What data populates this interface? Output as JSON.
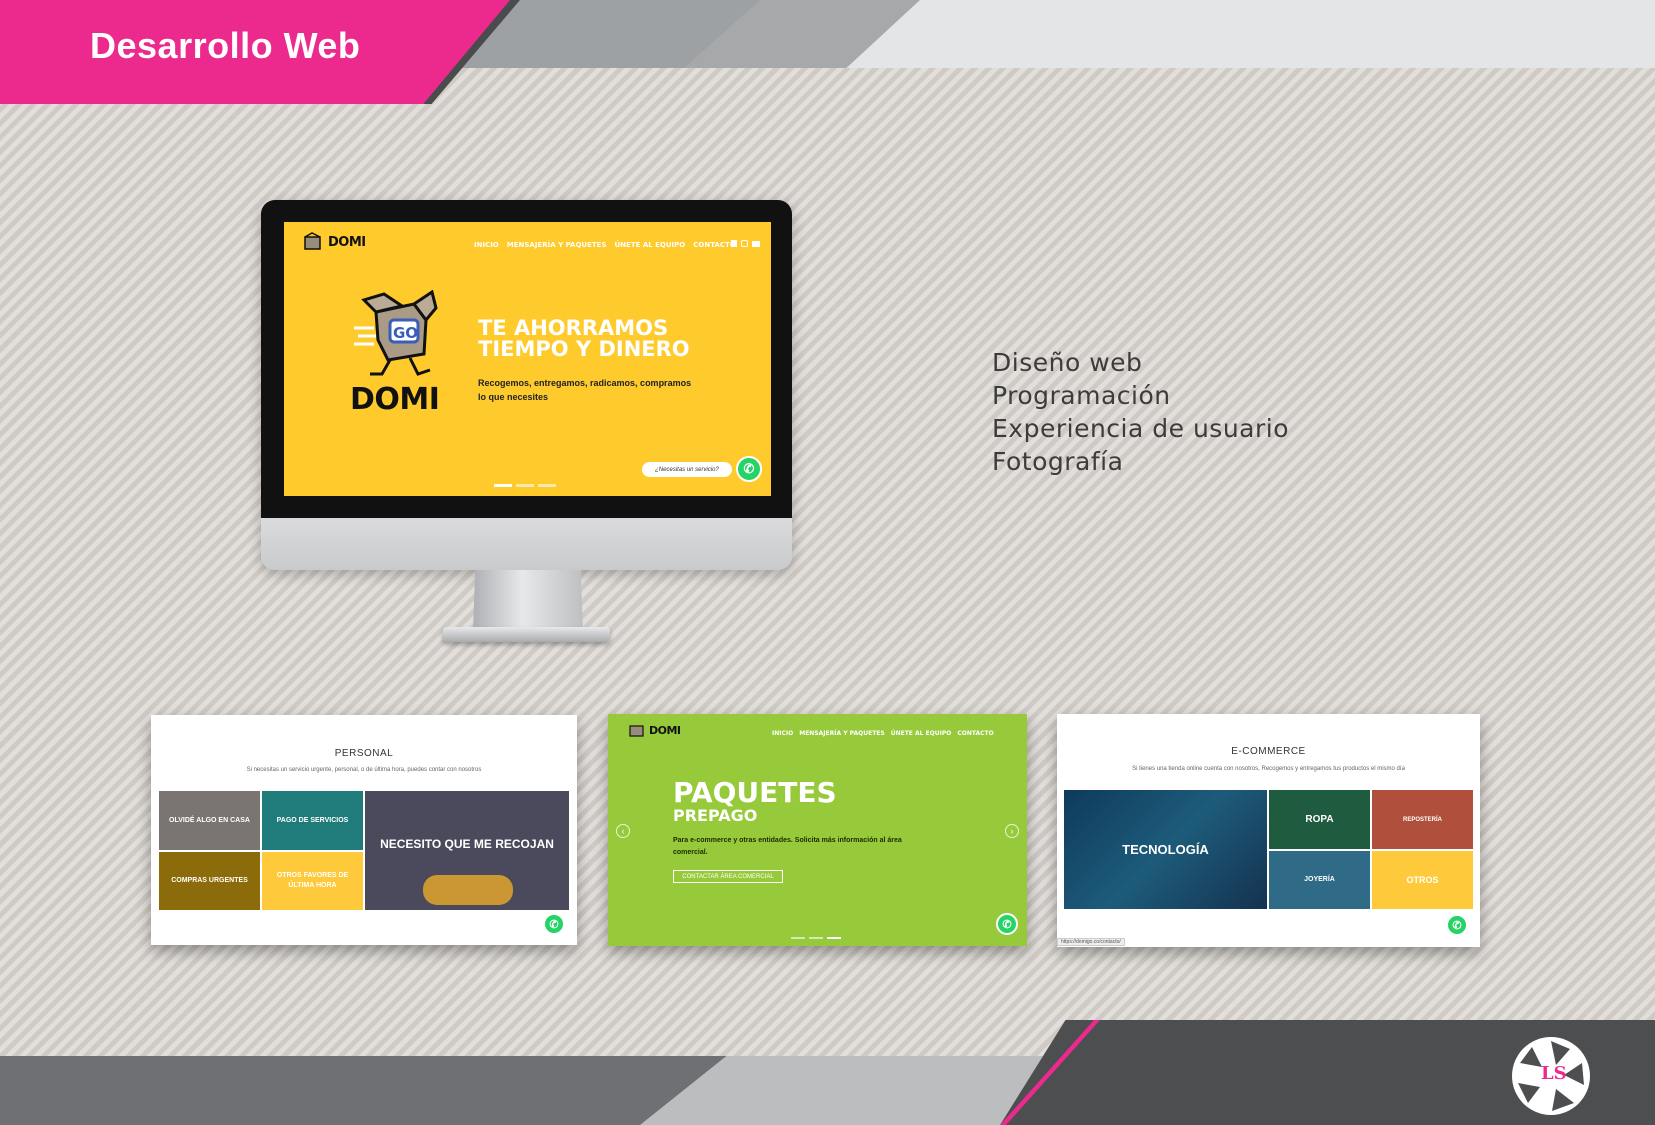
{
  "header": {
    "title": "Desarrollo Web"
  },
  "services": [
    "Diseño web",
    "Programación",
    "Experiencia de usuario",
    "Fotografía"
  ],
  "main_site": {
    "logo": "DOMI",
    "box_label": "GO",
    "nav": [
      "INICIO",
      "MENSAJERÍA Y PAQUETES",
      "ÚNETE AL EQUIPO",
      "CONTACTO"
    ],
    "hero_title_1": "TE AHORRAMOS",
    "hero_title_2": "TIEMPO Y DINERO",
    "hero_text": "Recogemos, entregamos, radicamos, compramos lo que necesites",
    "wa_prompt": "¿Necesitas un servicio?"
  },
  "thumb_personal": {
    "title": "PERSONAL",
    "subtitle": "Si necesitas un servicio urgente, personal, o de última hora, puedes contar con nosotros",
    "tiles": [
      {
        "label": "OLVIDÉ ALGO EN CASA",
        "color": "#7a7572"
      },
      {
        "label": "PAGO DE SERVICIOS",
        "color": "#1f7c7a"
      },
      {
        "label": "COMPRAS URGENTES",
        "color": "#8c6b0b"
      },
      {
        "label": "OTROS FAVORES DE ÚLTIMA HORA",
        "color": "#ffc93c"
      }
    ],
    "big_tile": "NECESITO QUE ME RECOJAN"
  },
  "thumb_paquetes": {
    "logo": "DOMI",
    "nav": [
      "INICIO",
      "MENSAJERÍA Y PAQUETES",
      "ÚNETE AL EQUIPO",
      "CONTACTO"
    ],
    "title": "PAQUETES",
    "subtitle": "PREPAGO",
    "text": "Para e-commerce y otras entidades. Solicita más información al área comercial.",
    "button": "CONTACTAR ÁREA COMERCIAL"
  },
  "thumb_ecommerce": {
    "title": "E-COMMERCE",
    "subtitle": "Si tienes una tienda online cuenta con nosotros, Recogemos y entregamos tus productos el mismo día",
    "big_tile": "TECNOLOGÍA",
    "tiles": [
      {
        "label": "ROPA",
        "color": "#1f5b3f"
      },
      {
        "label": "REPOSTERÍA",
        "color": "#b0503c"
      },
      {
        "label": "JOYERÍA",
        "color": "#2f6b86"
      },
      {
        "label": "OTROS",
        "color": "#ffc93c"
      }
    ],
    "status_url": "https://domigo.co/contacto/"
  },
  "colors": {
    "brand_pink": "#ec2a8e",
    "domi_yellow": "#ffca2c",
    "domi_green": "#96ca3a",
    "whatsapp": "#25d366"
  },
  "icons": [
    "whatsapp-icon",
    "facebook-icon",
    "instagram-icon",
    "email-icon",
    "box-mascot-icon",
    "aperture-logo-icon"
  ]
}
